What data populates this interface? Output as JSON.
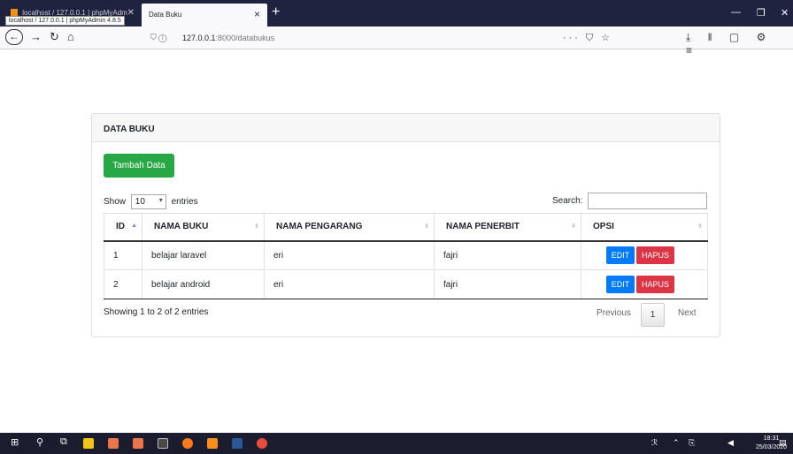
{
  "browser": {
    "inactive_tab_title": "localhost / 127.0.0.1 | phpMyAdm",
    "tooltip": "localhost / 127.0.0.1 | phpMyAdmin 4.8.5",
    "active_tab_title": "Data Buku",
    "url_host": "127.0.0.1",
    "url_path": ":8000/databukus"
  },
  "card": {
    "title": "DATA BUKU",
    "add_button": "Tambah Data"
  },
  "controls": {
    "show_label": "Show",
    "entries_value": "10",
    "entries_label": "entries",
    "search_label": "Search:"
  },
  "table": {
    "headers": [
      "ID",
      "NAMA BUKU",
      "NAMA PENGARANG",
      "NAMA PENERBIT",
      "OPSI"
    ],
    "rows": [
      {
        "id": "1",
        "nama_buku": "belajar laravel",
        "pengarang": "eri",
        "penerbit": "fajri",
        "edit": "EDIT",
        "hapus": "HAPUS"
      },
      {
        "id": "2",
        "nama_buku": "belajar android",
        "pengarang": "eri",
        "penerbit": "fajri",
        "edit": "EDIT",
        "hapus": "HAPUS"
      }
    ]
  },
  "footer": {
    "info": "Showing 1 to 2 of 2 entries",
    "previous": "Previous",
    "current_page": "1",
    "next": "Next"
  },
  "taskbar": {
    "time": "18:31",
    "date": "25/03/2020"
  }
}
